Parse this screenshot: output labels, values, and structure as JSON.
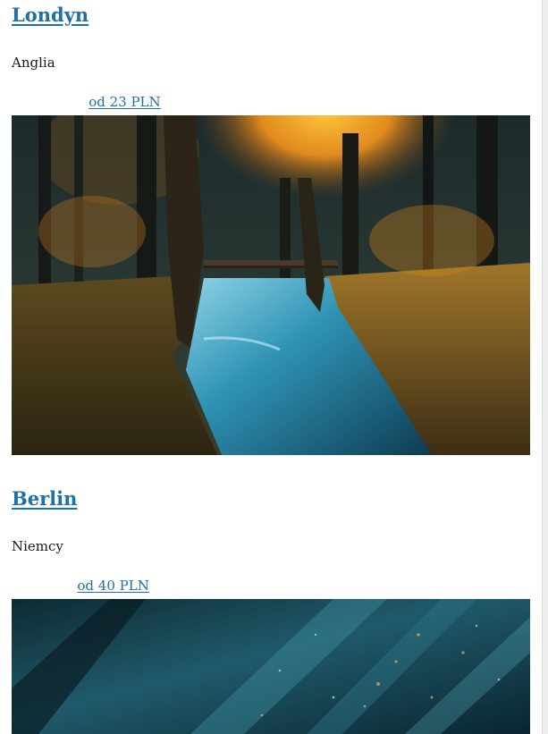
{
  "destinations": [
    {
      "city": "Londyn",
      "country": "Anglia",
      "price": "od 23 PLN",
      "photo": "autumn-forest-river"
    },
    {
      "city": "Berlin",
      "country": "Niemcy",
      "price": "od 40 PLN",
      "photo": "teal-glitter-abstract"
    }
  ],
  "colors": {
    "link": "#1f6fa8",
    "text": "#1a1a1a",
    "background": "#ffffff"
  }
}
